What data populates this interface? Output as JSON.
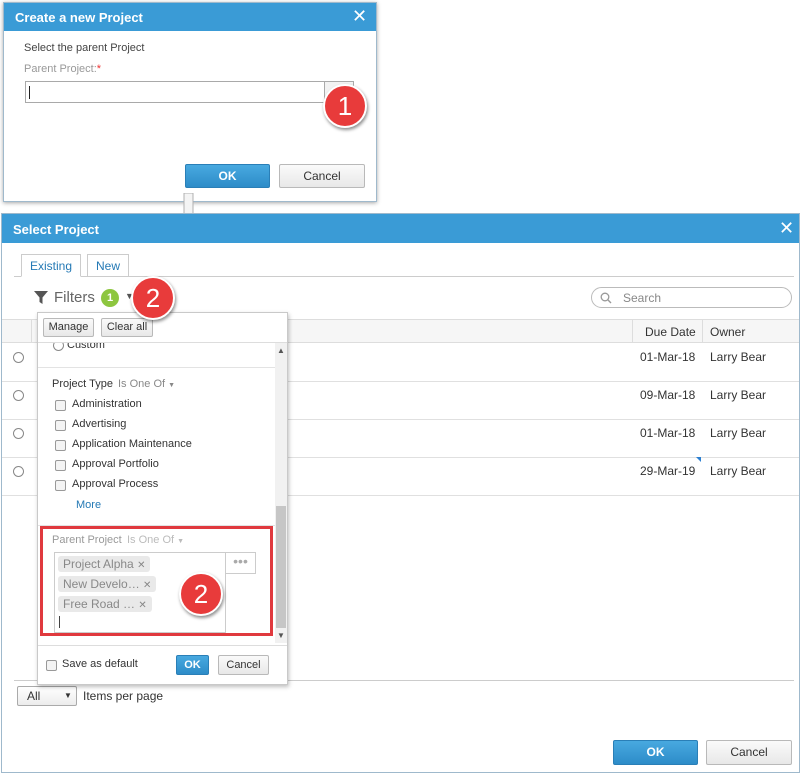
{
  "create_dialog": {
    "title": "Create a new Project",
    "instruction": "Select the parent Project",
    "parent_label": "Parent Project:",
    "required_mark": "*",
    "ok_label": "OK",
    "cancel_label": "Cancel"
  },
  "callout_1": "1",
  "callout_2": "2",
  "select_dialog": {
    "title": "Select Project",
    "tabs": [
      {
        "label": "Existing",
        "active": true
      },
      {
        "label": "New",
        "active": false
      }
    ],
    "filters_label": "Filters",
    "filter_count": "1",
    "search_placeholder": "Search",
    "columns": {
      "due_date": "Due Date",
      "owner": "Owner"
    },
    "rows": [
      {
        "due_date": "01-Mar-18",
        "owner": "Larry Bear"
      },
      {
        "due_date": "09-Mar-18",
        "owner": "Larry Bear"
      },
      {
        "due_date": "01-Mar-18",
        "owner": "Larry Bear"
      },
      {
        "due_date": "29-Mar-19",
        "owner": "Larry Bear"
      }
    ],
    "per_page_value": "All",
    "per_page_label": "Items per page",
    "ok_label": "OK",
    "cancel_label": "Cancel"
  },
  "filter_panel": {
    "manage_label": "Manage",
    "clear_all_label": "Clear all",
    "custom_label": "Custom",
    "project_type_label": "Project Type",
    "project_type_operator": "Is One Of",
    "project_types": [
      "Administration",
      "Advertising",
      "Application Maintenance",
      "Approval Portfolio",
      "Approval Process"
    ],
    "more_label": "More",
    "parent_project_label": "Parent Project",
    "parent_project_operator": "Is One Of",
    "parent_projects": [
      "Project Alpha",
      "New Develo…",
      "Free Road …"
    ],
    "save_default_label": "Save as default",
    "ok_label": "OK",
    "cancel_label": "Cancel"
  },
  "colors": {
    "title_bar": "#3a9bd6",
    "callout": "#e83b3b",
    "highlight_box": "#e0393e",
    "filter_badge": "#8dc63f"
  }
}
